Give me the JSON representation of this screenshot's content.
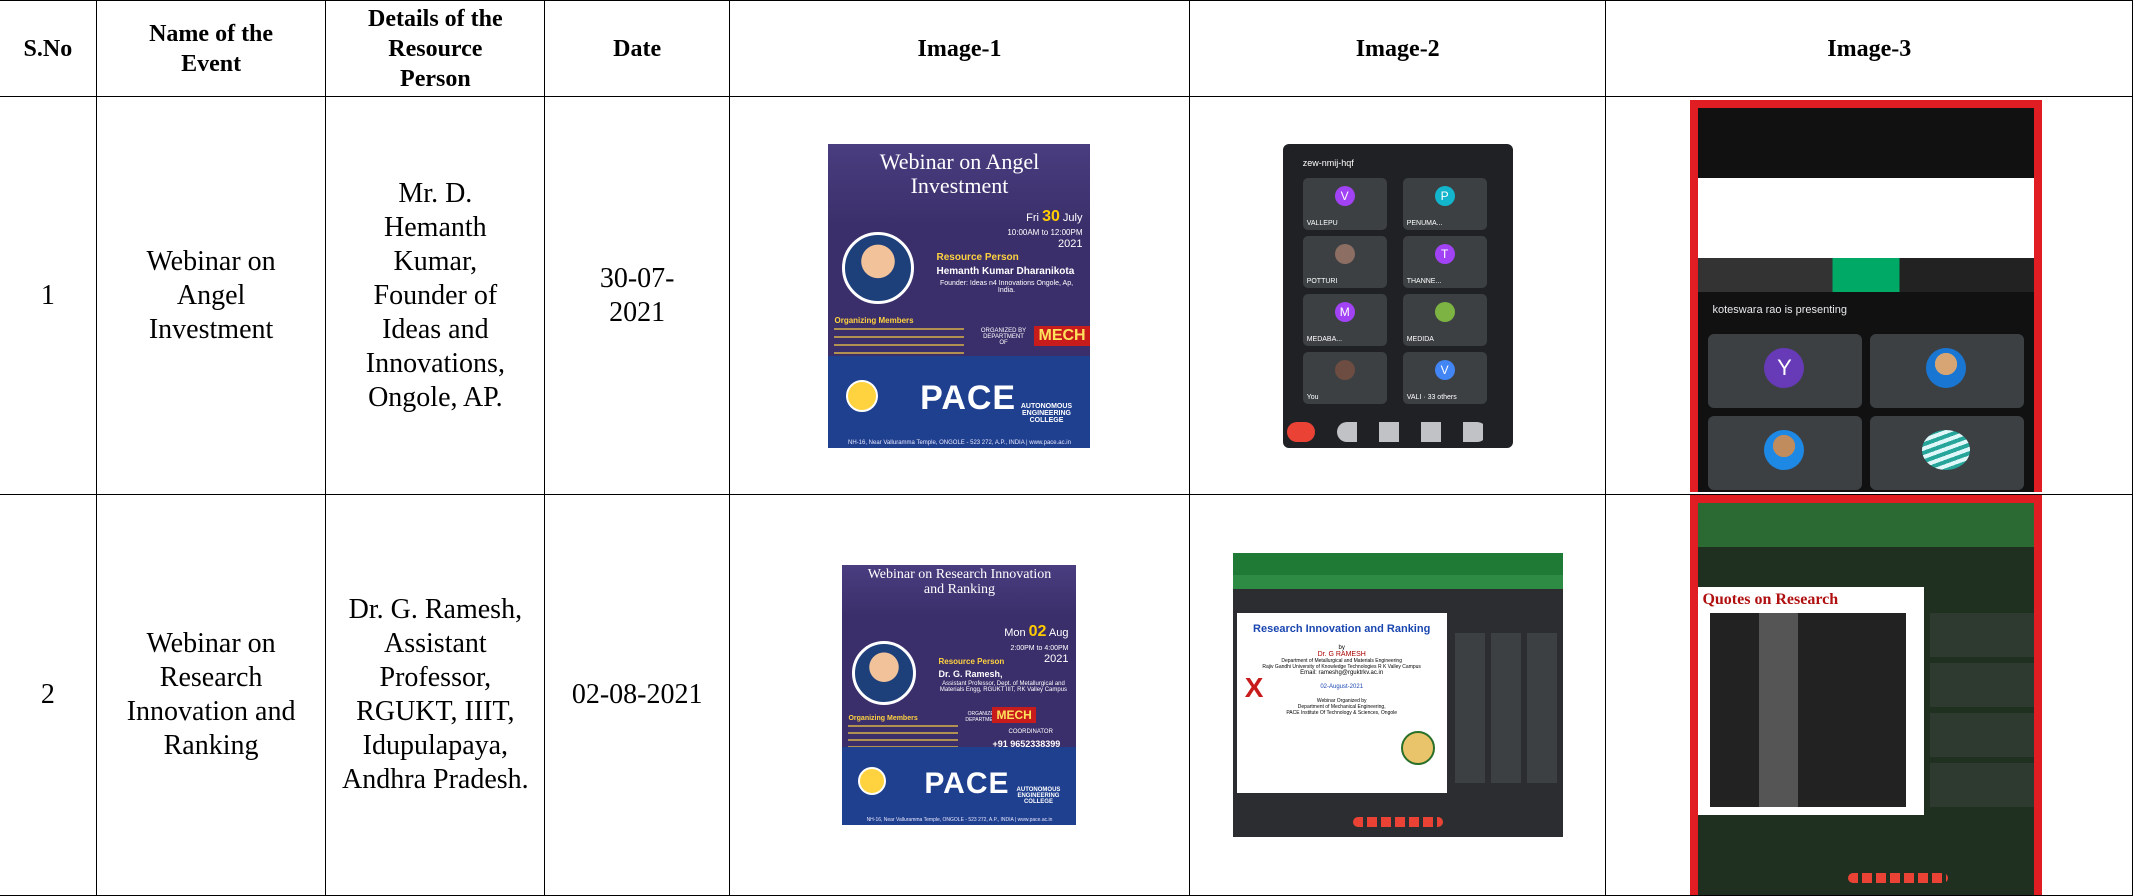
{
  "headers": {
    "sno": "S.No",
    "event": "Name of the Event",
    "resource": "Details of the Resource Person",
    "date": "Date",
    "image1": "Image-1",
    "image2": "Image-2",
    "image3": "Image-3"
  },
  "rows": [
    {
      "sno": "1",
      "event": "Webinar on Angel Investment",
      "resource": "Mr. D. Hemanth Kumar, Founder of Ideas and Innovations, Ongole, AP.",
      "date": "30-07-2021",
      "image1": {
        "title": "Webinar on Angel Investment",
        "day": "Fri",
        "daynum": "30",
        "month": "July",
        "time": "10:00AM to 12:00PM",
        "year": "2021",
        "rp_heading": "Resource Person",
        "rp_name": "Hemanth Kumar Dharanikota",
        "rp_detail": "Founder: Ideas n4 Innovations Ongole, Ap, India.",
        "org_heading": "Organizing Members",
        "organized_by": "ORGANIZED BY DEPARTMENT OF",
        "dept": "MECH",
        "brand": "PACE",
        "autonomous": "AUTONOMOUS ENGINEERING COLLEGE",
        "footer": "NH-16, Near Valluramma Temple, ONGOLE - 523 272, A.P., INDIA | www.pace.ac.in"
      },
      "image2": {
        "meeting_code": "zew-nmij-hqf",
        "participants": [
          "VALLEPU",
          "PENUMA...",
          "POTTURI",
          "THANNE...",
          "MEDABA...",
          "MEDIDA",
          "You",
          "VALI · 33 others"
        ],
        "initials": [
          "V",
          "P",
          "",
          "T",
          "M",
          "",
          "",
          "V"
        ]
      },
      "image3": {
        "banner": "koteswara rao is presenting",
        "tiles": [
          "Y",
          "",
          "",
          ""
        ]
      }
    },
    {
      "sno": "2",
      "event": "Webinar on Research Innovation and Ranking",
      "resource": "Dr. G. Ramesh, Assistant Professor, RGUKT, IIIT, Idupulapaya, Andhra Pradesh.",
      "date": "02-08-2021",
      "image1": {
        "title": "Webinar on Research Innovation and Ranking",
        "day": "Mon",
        "daynum": "02",
        "month": "Aug",
        "time": "2:00PM to 4:00PM",
        "year": "2021",
        "rp_heading": "Resource Person",
        "rp_name": "Dr. G. Ramesh,",
        "rp_detail": "Assistant Professor, Dept. of Metallurgical and Materials Engg, RGUKT IIIT, RK Valley Campus",
        "org_heading": "Organizing Members",
        "organized_by": "ORGANIZED BY DEPARTMENT OF",
        "dept": "MECH",
        "coordinator": "COORDINATOR",
        "phone": "+91 9652338399",
        "brand": "PACE",
        "autonomous": "AUTONOMOUS ENGINEERING COLLEGE",
        "footer": "NH-16, Near Valluramma Temple, ONGOLE - 523 272, A.P., INDIA | www.pace.ac.in"
      },
      "image2": {
        "slide_title": "Research Innovation and Ranking",
        "by": "by",
        "speaker": "Dr. G RAMESH",
        "affiliation": "Department of Metallurgical and Materials Engineering",
        "university": "Rajiv Gandhi University of Knowledge Technologies R K Valley Campus",
        "email": "Email: rameshg@rguktrkv.ac.in",
        "slide_date": "02-August-2021",
        "organized": "Webinar Organized by",
        "org_dept": "Department of Mechanical Engineering,",
        "org_inst": "PACE Institute Of Technology & Sciences, Ongole"
      },
      "image3": {
        "slide_heading": "Quotes on Research"
      }
    }
  ],
  "colors": {
    "border": "#000000",
    "frame_red": "#e11d24",
    "poster_purple": "#3b2f6b",
    "meet_dark": "#202124"
  }
}
